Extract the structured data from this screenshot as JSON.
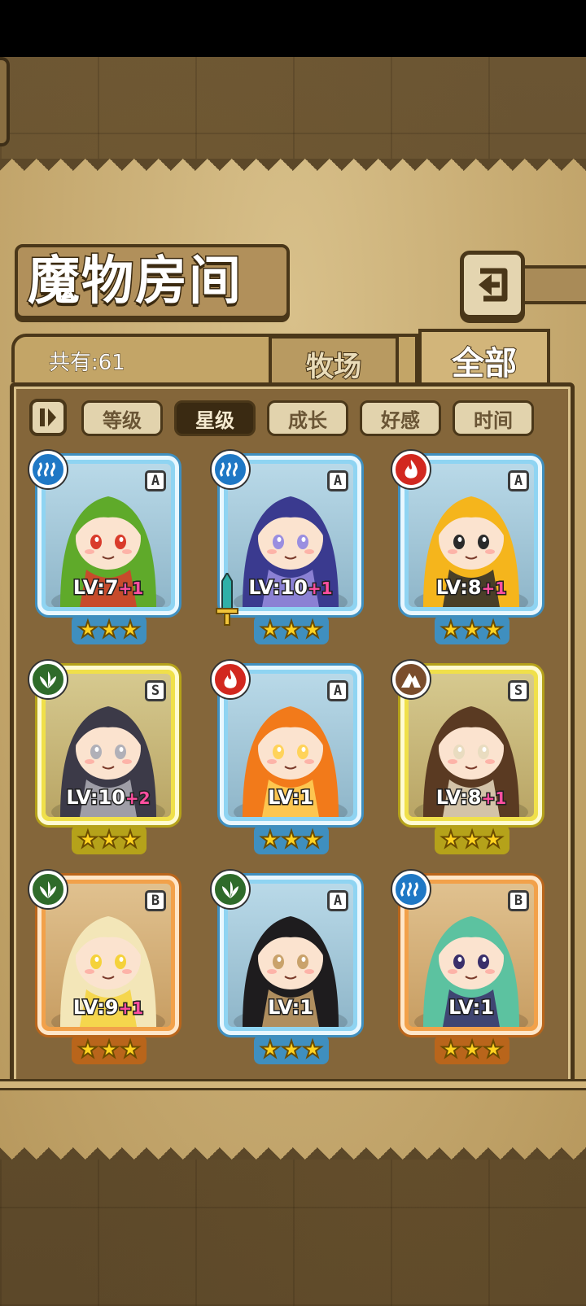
{
  "title": "魔物房间",
  "count_label": "共有:61",
  "tabs": [
    {
      "label": "牧场",
      "active": false
    },
    {
      "label": "全部",
      "active": true
    }
  ],
  "sort_buttons": [
    {
      "label": "等级",
      "active": false
    },
    {
      "label": "星级",
      "active": true
    },
    {
      "label": "成长",
      "active": false
    },
    {
      "label": "好感",
      "active": false
    },
    {
      "label": "时间",
      "active": false
    }
  ],
  "colors": {
    "rarity_A": "#8fd4f2",
    "rarity_S": "#f0e04a",
    "rarity_B": "#f2a14a",
    "bonus": "#ff4fa0",
    "star": "#ffd21f"
  },
  "monsters": [
    {
      "name": "frog-hood-girl",
      "element": "water",
      "rank": "A",
      "level": "LV:7",
      "bonus": "+1",
      "stars": 3,
      "hair": "#5faa2a",
      "accent": "#d93b2b",
      "equip": false
    },
    {
      "name": "jellyfish-girl",
      "element": "water",
      "rank": "A",
      "level": "LV:10",
      "bonus": "+1",
      "stars": 3,
      "hair": "#3a3a8f",
      "accent": "#9a8ee0",
      "equip": true
    },
    {
      "name": "thunder-girl",
      "element": "fire",
      "rank": "A",
      "level": "LV:8",
      "bonus": "+1",
      "stars": 3,
      "hair": "#f5b51c",
      "accent": "#2a2a2a",
      "equip": false
    },
    {
      "name": "owl-robe-girl",
      "element": "grass",
      "rank": "S",
      "level": "LV:10",
      "bonus": "+2",
      "stars": 3,
      "hair": "#3c3a48",
      "accent": "#b0b0b8",
      "equip": false
    },
    {
      "name": "flame-spirit-girl",
      "element": "fire",
      "rank": "A",
      "level": "LV:1",
      "bonus": "",
      "stars": 3,
      "hair": "#f27a1a",
      "accent": "#ffd35a",
      "equip": false
    },
    {
      "name": "ram-horn-girl",
      "element": "earth",
      "rank": "S",
      "level": "LV:8",
      "bonus": "+1",
      "stars": 3,
      "hair": "#5a3a22",
      "accent": "#e9dcc0",
      "equip": false
    },
    {
      "name": "cream-spirit-girl",
      "element": "grass",
      "rank": "B",
      "level": "LV:9",
      "bonus": "+1",
      "stars": 3,
      "hair": "#f3e6b8",
      "accent": "#f5d23a",
      "equip": false
    },
    {
      "name": "black-hair-warrior",
      "element": "grass",
      "rank": "A",
      "level": "LV:1",
      "bonus": "",
      "stars": 3,
      "hair": "#1e1c1e",
      "accent": "#c9a26b",
      "equip": false
    },
    {
      "name": "sea-serpent-girl",
      "element": "water",
      "rank": "B",
      "level": "LV:1",
      "bonus": "",
      "stars": 3,
      "hair": "#5cc2a0",
      "accent": "#3a2f6a",
      "equip": false
    }
  ]
}
